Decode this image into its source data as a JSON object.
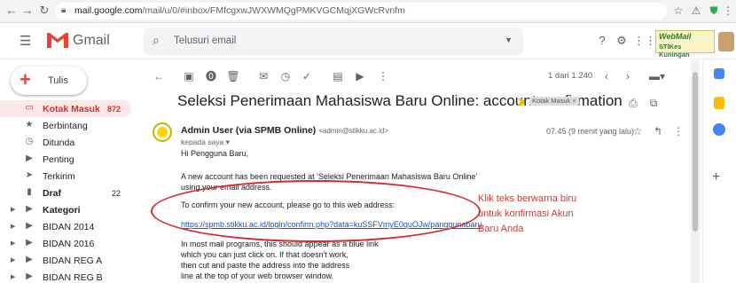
{
  "browser": {
    "back_icon": "back-arrow-icon",
    "forward_icon": "forward-arrow-icon",
    "reload_icon": "reload-icon",
    "url_host": "mail.google.com",
    "url_path": "/mail/u/0/#inbox/FMfcgxwJWXWMQgPMKVGCMqjXGWcRvnfm"
  },
  "header": {
    "app_name": "Gmail",
    "search_placeholder": "Telusuri email",
    "webmail_line1": "WebMail",
    "webmail_line2": "STIKes Kuningan"
  },
  "sidebar": {
    "compose_label": "Tulis",
    "items": [
      {
        "label": "Kotak Masuk",
        "count": "872",
        "icon": "inbox-icon"
      },
      {
        "label": "Berbintang",
        "count": "",
        "icon": "star-icon"
      },
      {
        "label": "Ditunda",
        "count": "",
        "icon": "clock-icon"
      },
      {
        "label": "Penting",
        "count": "",
        "icon": "important-icon"
      },
      {
        "label": "Terkirim",
        "count": "",
        "icon": "send-icon"
      },
      {
        "label": "Draf",
        "count": "22",
        "icon": "draft-icon"
      },
      {
        "label": "Kategori",
        "count": "",
        "icon": "label-icon"
      },
      {
        "label": "BIDAN 2014",
        "count": "",
        "icon": "label-icon"
      },
      {
        "label": "BIDAN 2016",
        "count": "",
        "icon": "label-icon"
      },
      {
        "label": "BIDAN REG A",
        "count": "",
        "icon": "label-icon"
      },
      {
        "label": "BIDAN REG B",
        "count": "",
        "icon": "label-icon"
      }
    ]
  },
  "toolbar": {
    "pager": "1 dari 1.240"
  },
  "message": {
    "subject": "Seleksi Penerimaan Mahasiswa Baru Online: account confirmation",
    "tag": "Kotak Masuk ×",
    "sender_name": "Admin User (via SPMB Online)",
    "sender_email": "<admin@stikku.ac.id>",
    "to": "kepada saya ▾",
    "time": "07.45 (9 menit yang lalu)",
    "greeting": "Hi Pengguna Baru,",
    "line1": "A new account has been requested at 'Seleksi Penerimaan Mahasiswa Baru Online'",
    "line2": "using your email address.",
    "line3": "To confirm your new account, please go to this web address:",
    "link": "https://spmb.stikku.ac.id/login/confirm.php?data=kuSSFVmyE0quOJw/panggunabaru",
    "line4": "In most mail programs, this should appear as a blue link",
    "line5": "which you can just click on. If that doesn't work,",
    "line6": "then cut and paste the address into the address",
    "line7": "line at the top of your web browser window."
  },
  "annotation": {
    "line1": "Klik teks berwarna biru",
    "line2": "untuk konfirmasi Akun",
    "line3": "Baru Anda",
    "color": "#e0322c"
  }
}
